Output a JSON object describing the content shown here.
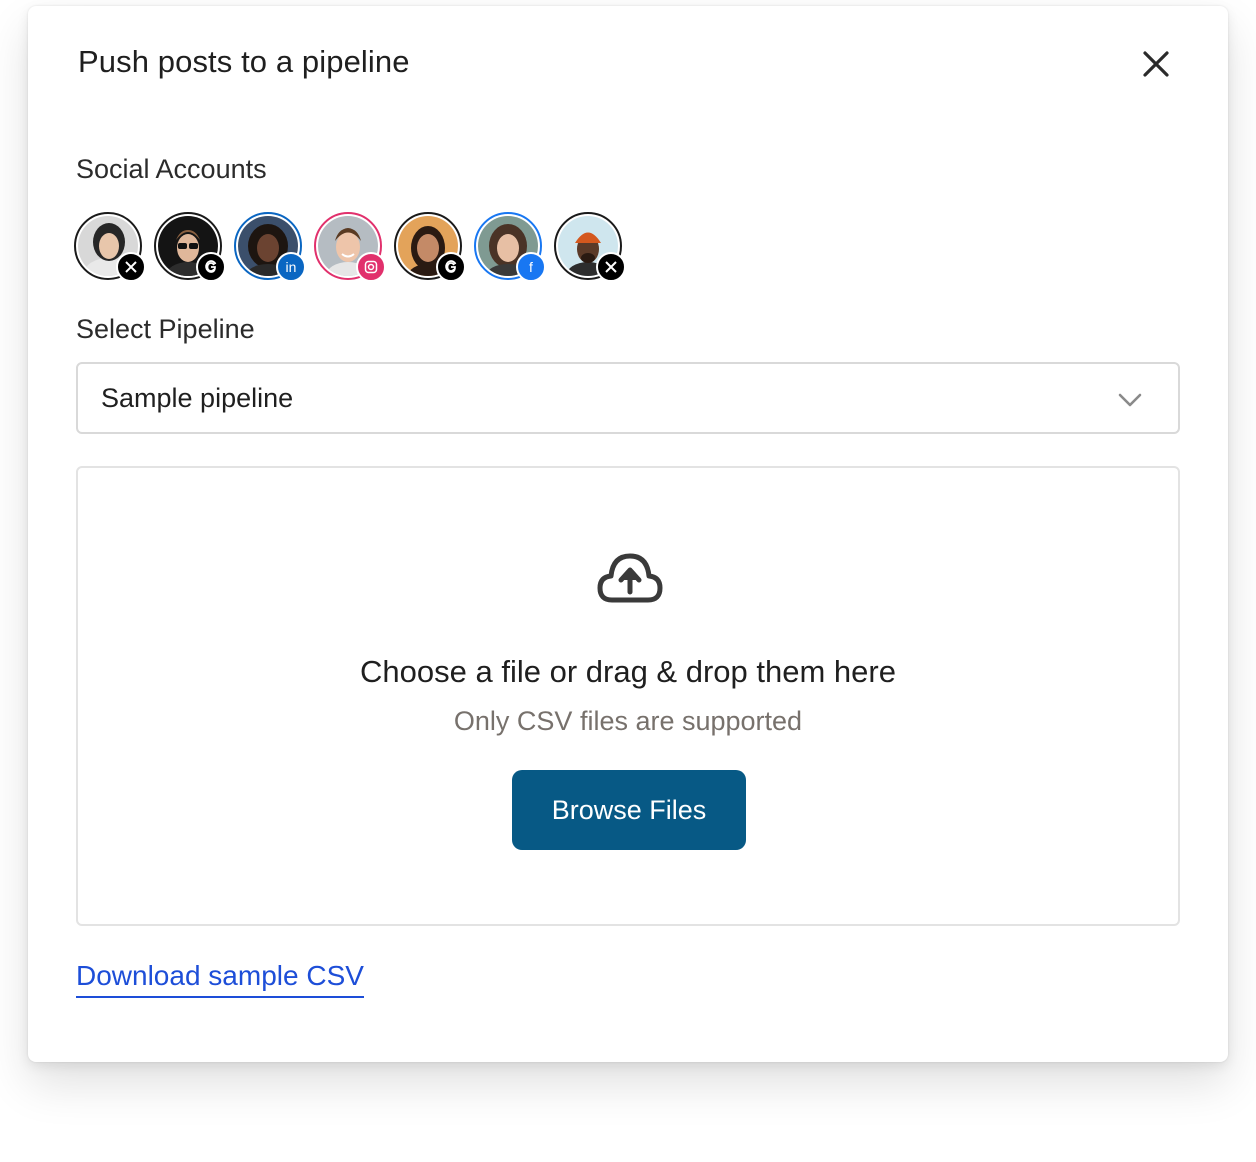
{
  "modal": {
    "title": "Push posts to a pipeline",
    "close_icon": "close-icon"
  },
  "social_accounts": {
    "label": "Social Accounts",
    "accounts": [
      {
        "platform": "x",
        "icon": "x-icon",
        "ring_color": "#1a1a1a",
        "badge_color": "#000000"
      },
      {
        "platform": "threads",
        "icon": "threads-icon",
        "ring_color": "#1a1a1a",
        "badge_color": "#000000"
      },
      {
        "platform": "linkedin",
        "icon": "linkedin-icon",
        "badge_text": "in",
        "ring_color": "#0a66c2",
        "badge_color": "#0a66c2"
      },
      {
        "platform": "instagram",
        "icon": "instagram-icon",
        "ring_color": "#e1306c",
        "badge_color": "#e1306c"
      },
      {
        "platform": "threads",
        "icon": "threads-icon",
        "ring_color": "#1a1a1a",
        "badge_color": "#000000"
      },
      {
        "platform": "facebook",
        "icon": "facebook-icon",
        "badge_text": "f",
        "ring_color": "#1877f2",
        "badge_color": "#1877f2"
      },
      {
        "platform": "x",
        "icon": "x-icon",
        "ring_color": "#1a1a1a",
        "badge_color": "#000000"
      }
    ]
  },
  "pipeline": {
    "label": "Select Pipeline",
    "selected": "Sample pipeline"
  },
  "dropzone": {
    "icon": "cloud-upload-icon",
    "title": "Choose a file or drag & drop them here",
    "subtitle": "Only CSV files are supported",
    "button_label": "Browse Files"
  },
  "download_link": "Download sample CSV",
  "colors": {
    "primary_button": "#075985",
    "link": "#1d4ed8",
    "muted_text": "#77716c",
    "border": "#d9d9d9"
  }
}
